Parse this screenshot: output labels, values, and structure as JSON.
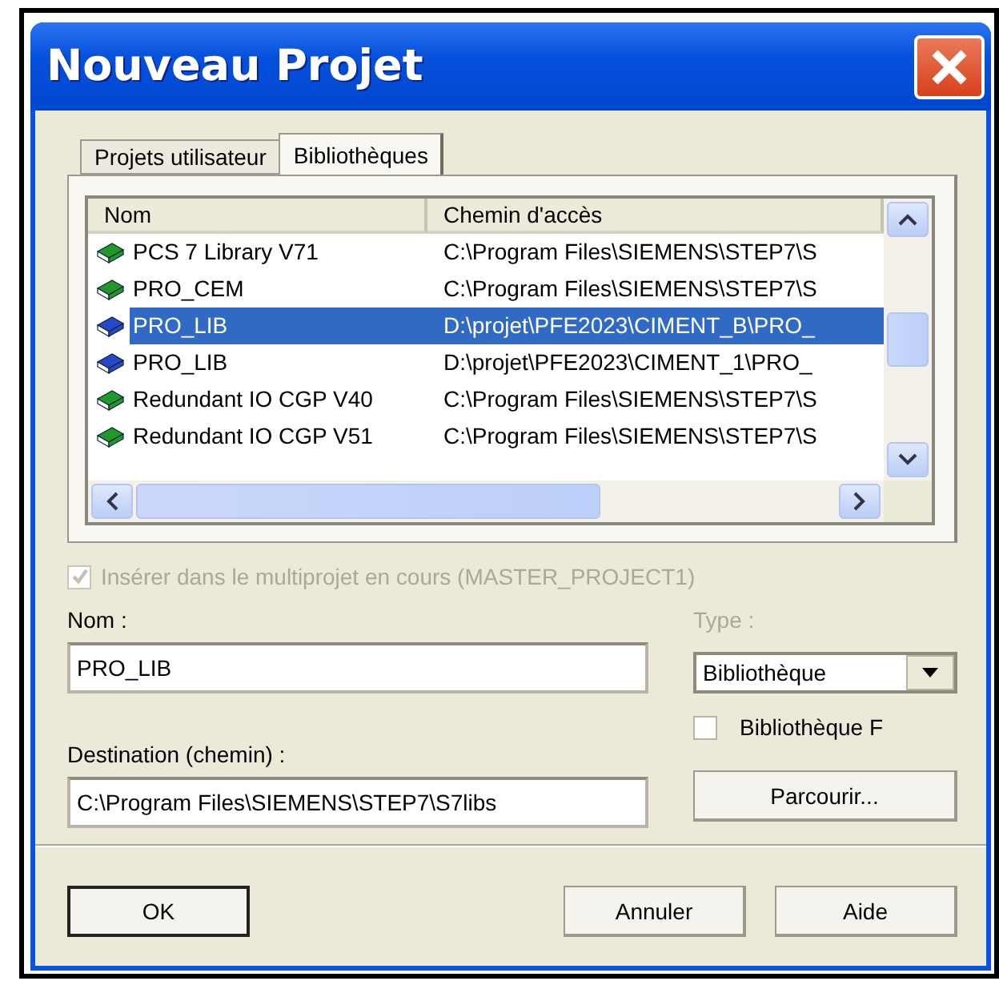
{
  "window": {
    "title": "Nouveau Projet"
  },
  "tabs": [
    {
      "label": "Projets utilisateur",
      "selected": false
    },
    {
      "label": "Bibliothèques",
      "selected": true
    }
  ],
  "list": {
    "columns": [
      "Nom",
      "Chemin d'accès"
    ],
    "rows": [
      {
        "name": "PCS 7 Library V71",
        "path": "C:\\Program Files\\SIEMENS\\STEP7\\S",
        "color": "#1f9a2a",
        "selected": false
      },
      {
        "name": "PRO_CEM",
        "path": "C:\\Program Files\\SIEMENS\\STEP7\\S",
        "color": "#1f9a2a",
        "selected": false
      },
      {
        "name": "PRO_LIB",
        "path": "D:\\projet\\PFE2023\\CIMENT_B\\PRO_",
        "color": "#2448c8",
        "selected": true
      },
      {
        "name": "PRO_LIB",
        "path": "D:\\projet\\PFE2023\\CIMENT_1\\PRO_",
        "color": "#2448c8",
        "selected": false
      },
      {
        "name": "Redundant IO CGP V40",
        "path": "C:\\Program Files\\SIEMENS\\STEP7\\S",
        "color": "#1f9a2a",
        "selected": false
      },
      {
        "name": "Redundant IO CGP V51",
        "path": "C:\\Program Files\\SIEMENS\\STEP7\\S",
        "color": "#1f9a2a",
        "selected": false
      }
    ]
  },
  "insert_checkbox": {
    "label": "Insérer dans le multiprojet en cours (MASTER_PROJECT1)",
    "checked": true,
    "disabled": true
  },
  "name_field": {
    "label": "Nom :",
    "value": "PRO_LIB"
  },
  "type_field": {
    "label": "Type :",
    "value": "Bibliothèque",
    "disabled": true
  },
  "lib_f_checkbox": {
    "label": "Bibliothèque F",
    "checked": false
  },
  "destination_field": {
    "label": "Destination (chemin) :",
    "value": "C:\\Program Files\\SIEMENS\\STEP7\\S7libs"
  },
  "browse_button": "Parcourir...",
  "buttons": [
    {
      "label": "OK",
      "default": true
    },
    {
      "label": "Annuler",
      "default": false
    },
    {
      "label": "Aide",
      "default": false
    }
  ]
}
